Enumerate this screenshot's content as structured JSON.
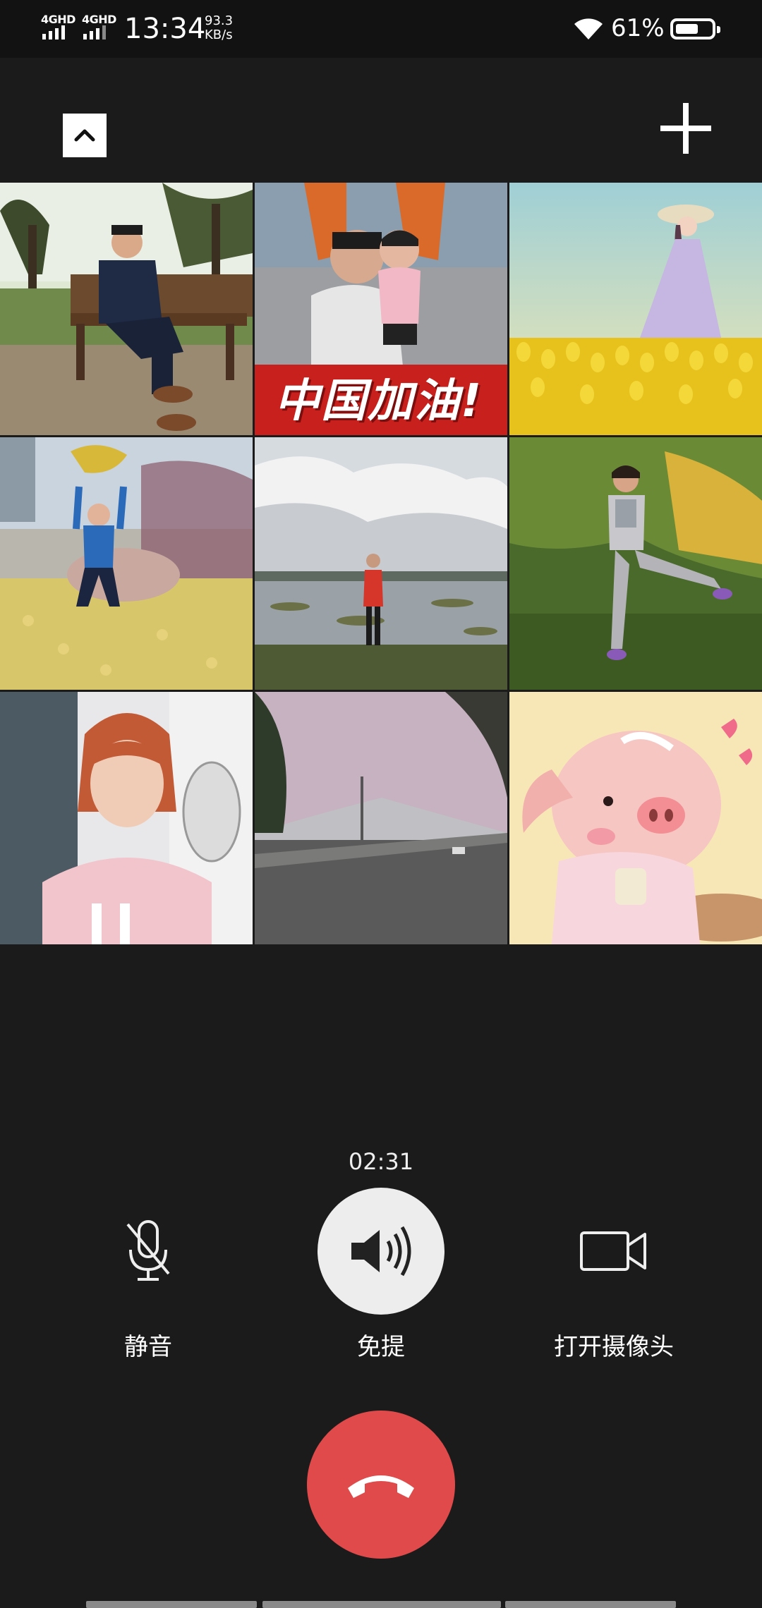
{
  "status_bar": {
    "network1": "4GHD",
    "network2": "4GHD",
    "time": "13:34",
    "speed_value": "93.3",
    "speed_unit": "KB/s",
    "battery": "61%",
    "battery_level": 0.61
  },
  "grid": {
    "banner_text": "中国加油!"
  },
  "call": {
    "timer": "02:31",
    "mute_label": "静音",
    "speaker_label": "免提",
    "camera_label": "打开摄像头",
    "hangup_color": "#e04a4a"
  },
  "icons": [
    "collapse-chevron-icon",
    "add-icon",
    "mute-mic-icon",
    "speaker-icon",
    "video-camera-icon",
    "hangup-phone-icon"
  ]
}
